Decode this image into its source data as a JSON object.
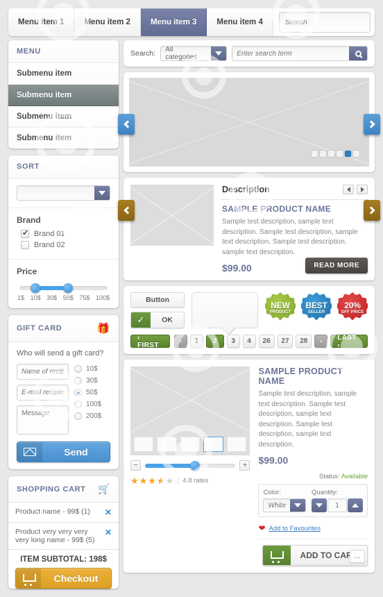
{
  "topbar": {
    "menu_items": [
      {
        "label": "Menu item 1",
        "active": false
      },
      {
        "label": "Menu item 2",
        "active": false
      },
      {
        "label": "Menu item 3",
        "active": true
      },
      {
        "label": "Menu item 4",
        "active": false
      }
    ],
    "search_placeholder": "Search",
    "search_icon": "magnifier-icon"
  },
  "sidebar": {
    "menu": {
      "title": "MENU",
      "items": [
        {
          "label": "Submenu item",
          "active": false
        },
        {
          "label": "Submenu item",
          "active": true
        },
        {
          "label": "Submenu item",
          "active": false
        },
        {
          "label": "Submenu item",
          "active": false
        }
      ]
    },
    "sort": {
      "title": "SORT",
      "select_value": "",
      "brand_title": "Brand",
      "brands": [
        {
          "label": "Brand 01",
          "checked": true
        },
        {
          "label": "Brand 02",
          "checked": false
        }
      ],
      "price_title": "Price",
      "price_ticks": [
        "1$",
        "10$",
        "30$",
        "50$",
        "75$",
        "100$"
      ],
      "price_min_pct": 18,
      "price_max_pct": 55
    },
    "giftcard": {
      "title": "GIFT CARD",
      "icon": "gift-icon",
      "question": "Who will send a gift card?",
      "name_placeholder": "Name of recipient",
      "email_placeholder": "E-mail recipient",
      "message_placeholder": "Message",
      "amounts": [
        {
          "label": "10$",
          "selected": false
        },
        {
          "label": "30$",
          "selected": false
        },
        {
          "label": "50$",
          "selected": true
        },
        {
          "label": "100$",
          "selected": false
        },
        {
          "label": "200$",
          "selected": false
        }
      ],
      "send_label": "Send"
    },
    "cart": {
      "title": "SHOPPING CART",
      "icon": "cart-icon",
      "items": [
        {
          "text": "Product name - 99$ (1)",
          "remove": "✕"
        },
        {
          "text": "Product very very very very long name - 99$ (5)",
          "remove": "✕"
        }
      ],
      "subtotal": "ITEM SUBTOTAL: 198$",
      "checkout_label": "Checkout"
    }
  },
  "main": {
    "search": {
      "label": "Search:",
      "category_value": "All categories",
      "term_placeholder": "Enter search term",
      "go_icon": "magnifier-icon"
    },
    "hero": {
      "prev_icon": "chevron-left-icon",
      "next_icon": "chevron-right-icon",
      "dots_total": 6,
      "dot_active_index": 4
    },
    "description": {
      "heading": "Description",
      "prev_mini_icon": "triangle-left-icon",
      "next_mini_icon": "triangle-right-icon",
      "product_name": "SAMPLE PRODUCT NAME",
      "body": "Sample test description, sample text description. Sample test description, sample text description. Sample test description, sample text description.",
      "price": "$99.00",
      "read_more_label": "READ MORE",
      "prev_icon": "chevron-left-icon",
      "next_icon": "chevron-right-icon"
    },
    "widgets": {
      "button_label": "Button",
      "ok_label": "OK",
      "ok_check_icon": "check-icon",
      "badges": [
        {
          "line1": "NEW",
          "line2": "PRODUCT",
          "color": "green"
        },
        {
          "line1": "BEST",
          "line2": "SELLER",
          "color": "blue"
        },
        {
          "line1": "20%",
          "line2": "OFF PRICE",
          "color": "red"
        }
      ]
    },
    "pagination": {
      "first_label": "‹ FIRST",
      "prev_label": "‹",
      "pages": [
        "1",
        "2",
        "3",
        "4",
        "…",
        "26",
        "27",
        "28"
      ],
      "active_page": "2",
      "next_label": "›",
      "last_label": "LAST ›"
    },
    "product": {
      "name": "SAMPLE PRODUCT NAME",
      "body": "Sample test description, sample text description. Sample test description, sample text description. Sample test description, sample text description.",
      "price": "$99.00",
      "status_label": "Status:",
      "status_value": "Available",
      "color_label": "Color:",
      "color_value": "White",
      "quantity_label": "Quantity:",
      "quantity_value": "1",
      "favourites_label": "Add to Favourites",
      "favourites_icon": "heart-icon",
      "add_to_cart_label": "ADD TO CART",
      "add_to_cart_icon": "cart-icon",
      "thumbs_total": 5,
      "thumb_selected_index": 3,
      "zoom_minus": "−",
      "zoom_plus": "+",
      "zoom_pct": 55,
      "stars_filled": 3.5,
      "stars_total": 5,
      "rates_label": "4.8 rates"
    }
  },
  "colors": {
    "accent_blue": "#6b7499",
    "link_blue": "#3b7cc4",
    "green": "#5c832d",
    "gold": "#dba024",
    "red": "#c01c1c",
    "slider_blue": "#4aa3e8"
  }
}
